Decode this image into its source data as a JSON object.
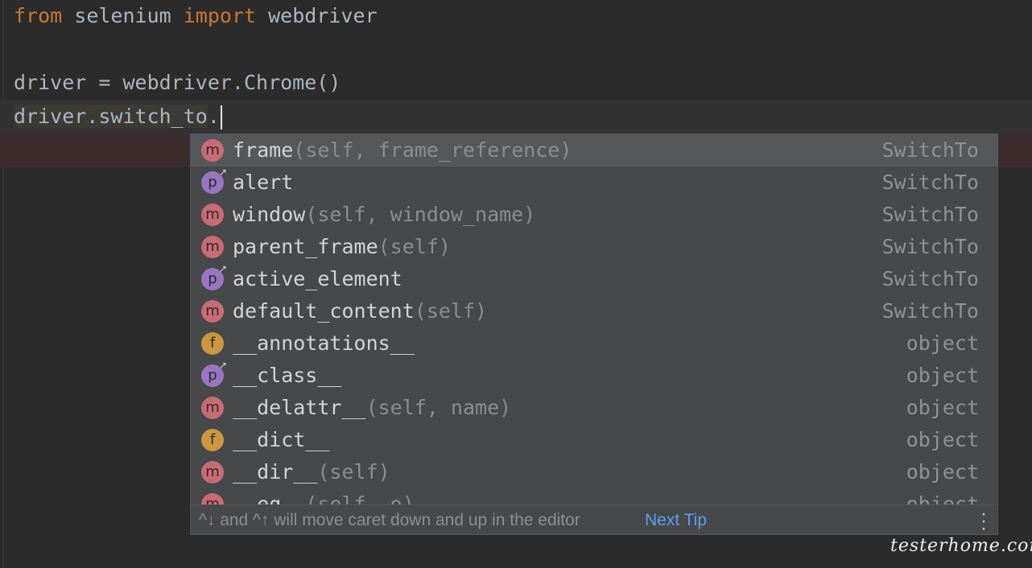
{
  "code": {
    "line1": {
      "kw1": "from",
      "mid": " selenium ",
      "kw2": "import",
      "rest": " webdriver"
    },
    "line3": "driver = webdriver.Chrome()",
    "line4": {
      "ref": "driver.switch_to",
      "dot": "."
    }
  },
  "completion": {
    "items": [
      {
        "icon": "m",
        "name": "frame",
        "sig": "(self, frame_reference)",
        "type": "SwitchTo"
      },
      {
        "icon": "p",
        "name": "alert",
        "sig": "",
        "type": "SwitchTo"
      },
      {
        "icon": "m",
        "name": "window",
        "sig": "(self, window_name)",
        "type": "SwitchTo"
      },
      {
        "icon": "m",
        "name": "parent_frame",
        "sig": "(self)",
        "type": "SwitchTo"
      },
      {
        "icon": "p",
        "name": "active_element",
        "sig": "",
        "type": "SwitchTo"
      },
      {
        "icon": "m",
        "name": "default_content",
        "sig": "(self)",
        "type": "SwitchTo"
      },
      {
        "icon": "f",
        "name": "__annotations__",
        "sig": "",
        "type": "object"
      },
      {
        "icon": "p",
        "name": "__class__",
        "sig": "",
        "type": "object"
      },
      {
        "icon": "m",
        "name": "__delattr__",
        "sig": "(self, name)",
        "type": "object"
      },
      {
        "icon": "f",
        "name": "__dict__",
        "sig": "",
        "type": "object"
      },
      {
        "icon": "m",
        "name": "__dir__",
        "sig": "(self)",
        "type": "object"
      },
      {
        "icon": "m",
        "name": "__eq__",
        "sig": "(self, o)",
        "type": "object"
      }
    ],
    "footer": {
      "tip": "^↓ and ^↑ will move caret down and up in the editor",
      "next_tip": "Next Tip"
    }
  },
  "watermark": "testerhome.com",
  "colors": {
    "background": "#2b2b2b",
    "keyword": "#cc7832",
    "method_icon": "#c86b75",
    "property_icon": "#9876c2",
    "field_icon": "#c9973e",
    "link": "#5a9ff5"
  }
}
